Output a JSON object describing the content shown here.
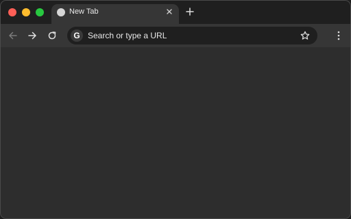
{
  "window": {
    "traffic_lights": [
      "close",
      "minimize",
      "zoom"
    ],
    "colors": {
      "close": "#fe5f57",
      "minimize": "#febc2e",
      "zoom": "#28c840",
      "background": "#2d2d2d"
    }
  },
  "tabs": [
    {
      "title": "New Tab",
      "favicon": "globe-icon",
      "active": true
    }
  ],
  "toolbar": {
    "back_icon": "arrow-left-icon",
    "forward_icon": "arrow-right-icon",
    "reload_icon": "reload-icon",
    "menu_icon": "kebab-menu-icon"
  },
  "omnibox": {
    "search_engine_icon": "G",
    "placeholder": "Search or type a URL",
    "bookmark_icon": "star-icon"
  }
}
